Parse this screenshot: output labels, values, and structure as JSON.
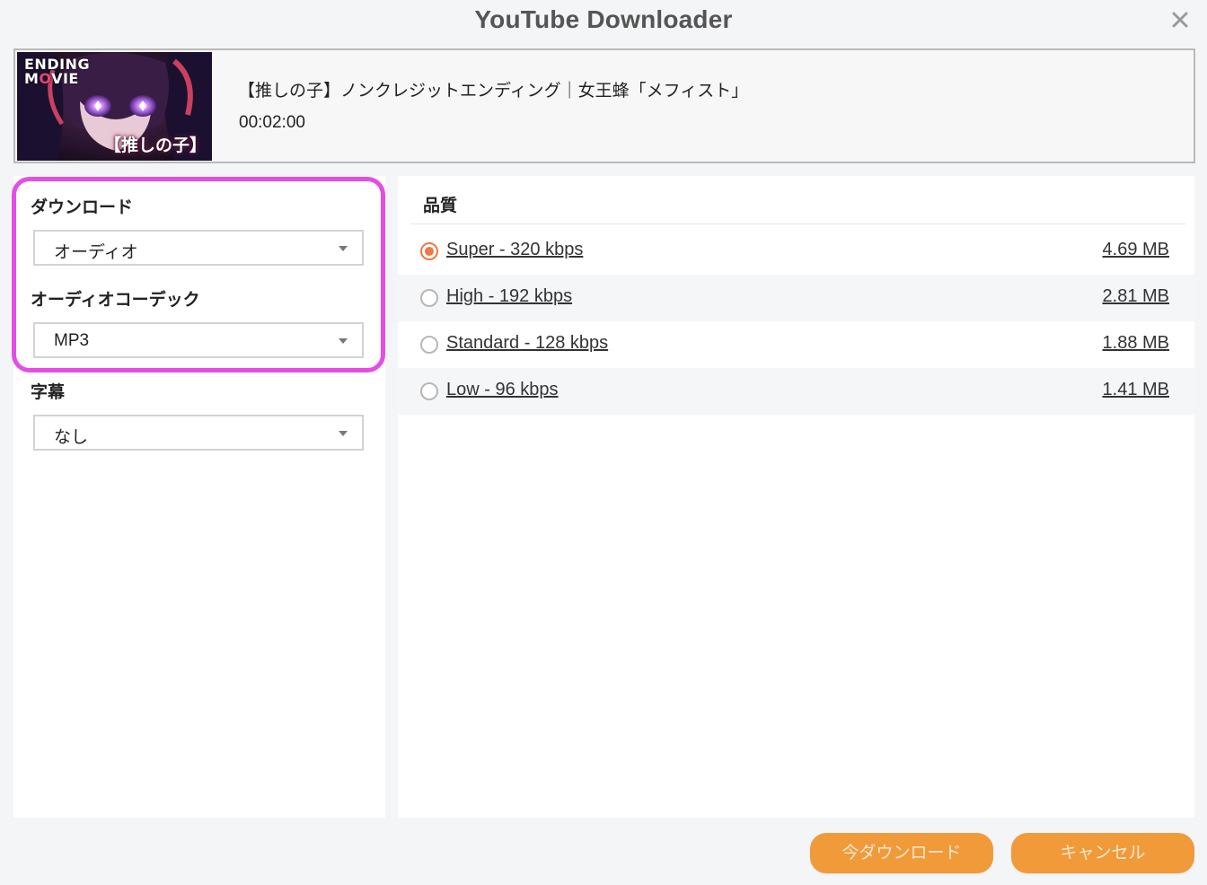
{
  "window": {
    "title": "YouTube Downloader"
  },
  "video": {
    "thumbnail_tag_line1_pre": "ENDING",
    "thumbnail_tag_line2_a": "M",
    "thumbnail_tag_line2_o": "O",
    "thumbnail_tag_line2_b": "VIE",
    "thumbnail_logo": "【推しの子】",
    "title": "【推しの子】ノンクレジットエンディング｜女王蜂「メフィスト」",
    "duration": "00:02:00"
  },
  "left": {
    "download_label": "ダウンロード",
    "download_value": "オーディオ",
    "codec_label": "オーディオコーデック",
    "codec_value": "MP3",
    "subtitle_label": "字幕",
    "subtitle_value": "なし"
  },
  "quality": {
    "heading": "品質",
    "selected_index": 0,
    "options": [
      {
        "label": "Super - 320 kbps",
        "size": "4.69 MB"
      },
      {
        "label": "High - 192 kbps",
        "size": "2.81 MB"
      },
      {
        "label": "Standard - 128 kbps",
        "size": "1.88 MB"
      },
      {
        "label": "Low - 96 kbps",
        "size": "1.41 MB"
      }
    ]
  },
  "buttons": {
    "download_now": "今ダウンロード",
    "cancel": "キャンセル"
  },
  "colors": {
    "accent_orange": "#f19a3a",
    "radio_orange": "#ec7a45",
    "highlight_magenta": "#e44de6",
    "panel_bg": "#ffffff",
    "window_bg": "#f4f5f7"
  }
}
